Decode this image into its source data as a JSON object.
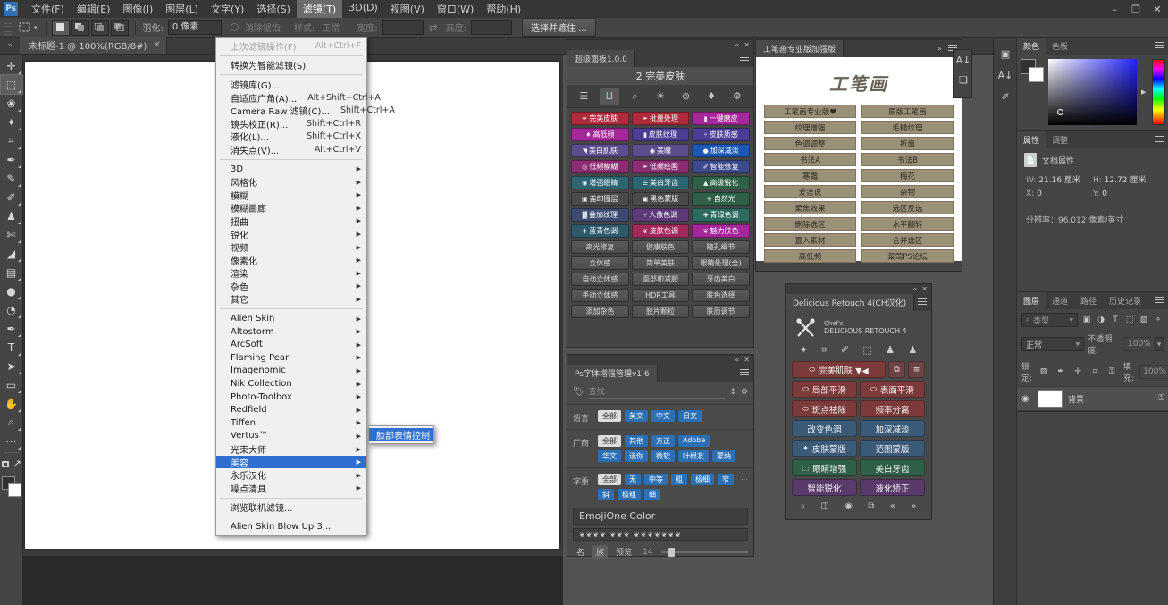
{
  "menubar": {
    "logo": "Ps",
    "items": [
      {
        "label": "文件(F)"
      },
      {
        "label": "编辑(E)"
      },
      {
        "label": "图像(I)"
      },
      {
        "label": "图层(L)"
      },
      {
        "label": "文字(Y)"
      },
      {
        "label": "选择(S)"
      },
      {
        "label": "滤镜(T)",
        "active": true
      },
      {
        "label": "3D(D)"
      },
      {
        "label": "视图(V)"
      },
      {
        "label": "窗口(W)"
      },
      {
        "label": "帮助(H)"
      }
    ],
    "window_controls": [
      "–",
      "❐",
      "✕"
    ]
  },
  "options_bar": {
    "tool_icon": "rect-marquee-icon",
    "preset_chevron": "▾",
    "mode_buttons": [
      "new-selection",
      "add-to-selection",
      "subtract-from-selection",
      "intersect-selection"
    ],
    "feather_label": "羽化:",
    "feather_value": "0 像素",
    "antialias_label": "消除锯齿",
    "style_label": "样式:",
    "style_value": "正常",
    "width_label": "宽度:",
    "width_value": "",
    "height_label": "高度:",
    "height_value": "",
    "select_and_mask": "选择并遮住 ..."
  },
  "tabbar": {
    "collapse_icon": "»",
    "document_tab": "未标题-1 @ 100%(RGB/8#)",
    "close_icon": "✕"
  },
  "toolbar": {
    "tools": [
      {
        "name": "move-tool",
        "glyph": "✛"
      },
      {
        "name": "rectangular-marquee-tool",
        "glyph": "⬚",
        "selected": true
      },
      {
        "name": "lasso-tool",
        "glyph": "❀"
      },
      {
        "name": "quick-selection-tool",
        "glyph": "✦"
      },
      {
        "name": "crop-tool",
        "glyph": "⌗"
      },
      {
        "name": "eyedropper-tool",
        "glyph": "✒"
      },
      {
        "name": "healing-brush-tool",
        "glyph": "✎"
      },
      {
        "name": "brush-tool",
        "glyph": "✐"
      },
      {
        "name": "clone-stamp-tool",
        "glyph": "♟"
      },
      {
        "name": "history-brush-tool",
        "glyph": "✄"
      },
      {
        "name": "eraser-tool",
        "glyph": "◢"
      },
      {
        "name": "gradient-tool",
        "glyph": "▤"
      },
      {
        "name": "blur-tool",
        "glyph": "●"
      },
      {
        "name": "dodge-tool",
        "glyph": "◔"
      },
      {
        "name": "pen-tool",
        "glyph": "✒"
      },
      {
        "name": "type-tool",
        "glyph": "T"
      },
      {
        "name": "path-selection-tool",
        "glyph": "➤"
      },
      {
        "name": "rectangle-tool",
        "glyph": "▭"
      },
      {
        "name": "hand-tool",
        "glyph": "✋"
      },
      {
        "name": "zoom-tool",
        "glyph": "⌕"
      },
      {
        "name": "edit-toolbar-tool",
        "glyph": "⋯"
      }
    ],
    "quickmask_icon": "quick-mask-icon",
    "screenmode_icon": "screen-mode-icon"
  },
  "superpanel": {
    "tab_title": "超级面板1.0.0",
    "section_title": "2 完美皮肤",
    "icons": [
      {
        "name": "document-icon",
        "glyph": "☰"
      },
      {
        "name": "curve-icon",
        "glyph": "⨿",
        "active": true
      },
      {
        "name": "search-icon",
        "glyph": "⌕"
      },
      {
        "name": "brightness-icon",
        "glyph": "☀"
      },
      {
        "name": "channels-icon",
        "glyph": "⊚"
      },
      {
        "name": "diamond-icon",
        "glyph": "♦"
      },
      {
        "name": "settings-icon",
        "glyph": "⚙"
      }
    ],
    "color_buttons": [
      {
        "label": "完美皮肤",
        "icon": "✒",
        "color": "#b02a3c"
      },
      {
        "label": "批量处理",
        "icon": "✒",
        "color": "#b02a3c"
      },
      {
        "label": "一键磨皮",
        "icon": "▮",
        "color": "#a5279a"
      },
      {
        "label": "高低频",
        "icon": "♦",
        "color": "#a5279a"
      },
      {
        "label": "皮肤纹理",
        "icon": "▮",
        "color": "#4b3c96"
      },
      {
        "label": "皮肤质感",
        "icon": "⑂",
        "color": "#4b3c96"
      },
      {
        "label": "美白肌肤",
        "icon": "◥",
        "color": "#5c4d8c"
      },
      {
        "label": "美瞳",
        "icon": "◉",
        "color": "#5c4d8c"
      },
      {
        "label": "加深减淡",
        "icon": "●",
        "color": "#1b58b5"
      },
      {
        "label": "低频模糊",
        "icon": "◎",
        "color": "#8c2c72"
      },
      {
        "label": "低频绘画",
        "icon": "✒",
        "color": "#8c2c72"
      },
      {
        "label": "智能修复",
        "icon": "✐",
        "color": "#3b4a8c"
      },
      {
        "label": "增强眼睛",
        "icon": "◉",
        "color": "#2d6673"
      },
      {
        "label": "美白牙齿",
        "icon": "☰",
        "color": "#2d6673"
      },
      {
        "label": "高级锐化",
        "icon": "▲",
        "color": "#2d6046"
      },
      {
        "label": "盖印图层",
        "icon": "▣",
        "color": "#4a4a4a"
      },
      {
        "label": "黑色蒙版",
        "icon": "▣",
        "color": "#4a4a4a"
      },
      {
        "label": "自然光",
        "icon": "☀",
        "color": "#2d6046"
      },
      {
        "label": "叠加纹理",
        "icon": "▓",
        "color": "#3b4a70"
      },
      {
        "label": "人像色调",
        "icon": "⑂",
        "color": "#5c3a7a"
      },
      {
        "label": "青绿色调",
        "icon": "✚",
        "color": "#2d6b5e"
      },
      {
        "label": "蓝青色调",
        "icon": "✚",
        "color": "#2d5a6b"
      },
      {
        "label": "皮肤色调",
        "icon": "❦",
        "color": "#a02a5c"
      },
      {
        "label": "魅力肤色",
        "icon": "❦",
        "color": "#a5279a"
      }
    ],
    "gray_buttons": [
      "高光修复",
      "健康肤色",
      "瞳孔细节",
      "立体感",
      "简单美肤",
      "眼睛处理(全)",
      "自动立体感",
      "面部和减肥",
      "牙齿美白",
      "手动立体感",
      "HDR工具",
      "肤色选择",
      "添加杂色",
      "胶片颗粒",
      "肤质调节"
    ]
  },
  "fontpanel": {
    "tab_title": "Ps字体增强管理v1.6",
    "tag_icon": "tag-icon",
    "search_placeholder": "查找",
    "sort_icon": "↕",
    "gear_icon": "⚙",
    "language_label": "语言",
    "language_chips": [
      {
        "label": "全部",
        "selected": true
      },
      {
        "label": "英文"
      },
      {
        "label": "中文"
      },
      {
        "label": "日文"
      }
    ],
    "vendor_label": "厂商",
    "vendor_chips": [
      {
        "label": "全部",
        "selected": true
      },
      {
        "label": "其他"
      },
      {
        "label": "方正"
      },
      {
        "label": "Adobe"
      },
      {
        "label": "华文"
      },
      {
        "label": "迷你"
      },
      {
        "label": "微软"
      },
      {
        "label": "叶根友"
      },
      {
        "label": "蒙纳"
      }
    ],
    "vendor_more": "⋯",
    "weight_label": "字重",
    "weight_chips": [
      {
        "label": "全部",
        "selected": true
      },
      {
        "label": "无"
      },
      {
        "label": "中等"
      },
      {
        "label": "粗"
      },
      {
        "label": "极细"
      },
      {
        "label": "窄"
      },
      {
        "label": "斜"
      },
      {
        "label": "极粗"
      },
      {
        "label": "细"
      }
    ],
    "weight_more": "⋯",
    "font_name": "EmojiOne Color",
    "font_sample": "❦❦❦❦ ❦❦❦ ❦❦❦❦❦❦❦",
    "footer_toggles": [
      {
        "label": "名"
      },
      {
        "label": "族",
        "selected": true
      },
      {
        "label": "预览"
      }
    ],
    "size_value": "14"
  },
  "gongbi": {
    "tab_title": "工笔画专业版加强版",
    "expand_icon": "»",
    "logo_text": "工笔画",
    "buttons": [
      "工笔画专业版♥",
      "原版工笔画",
      "纹理增强",
      "毛糙纹理",
      "色调调整",
      "折扇",
      "书法A",
      "书法B",
      "寒霜",
      "梅花",
      "爱莲说",
      "杂物",
      "柔焦效果",
      "选区反选",
      "删除选区",
      "水平翻转",
      "置入素材",
      "合并选区",
      "高低频",
      "菜莺PS论坛"
    ]
  },
  "retouch": {
    "tab_title": "Delicious Retouch 4(CH汉化)",
    "brand_small": "Chef's",
    "brand_large": "DELICIOUS RETOUCH 4",
    "logo_icon": "crossed-utensils-icon",
    "tool_icons": [
      {
        "name": "magic-wand-icon",
        "glyph": "✦"
      },
      {
        "name": "bandage-icon",
        "glyph": "⌗"
      },
      {
        "name": "brush-icon",
        "glyph": "✐"
      },
      {
        "name": "marquee-icon",
        "glyph": "⬚"
      },
      {
        "name": "stamp-icon",
        "glyph": "♟"
      },
      {
        "name": "stamp-plus-icon",
        "glyph": "♟"
      }
    ],
    "rows": [
      [
        {
          "label": "完美肌肤 ▼◀",
          "color": "#7d3a3a",
          "icon": "⬭",
          "flex": 3
        },
        {
          "square": true,
          "icon": "⧉"
        },
        {
          "square": true,
          "icon": "≡"
        }
      ],
      [
        {
          "label": "局部平滑",
          "color": "#7d3a3a",
          "icon": "⬭"
        },
        {
          "label": "表面平滑",
          "color": "#7d3a3a",
          "icon": "⬭"
        }
      ],
      [
        {
          "label": "斑点祛除",
          "color": "#7d3a3a",
          "icon": "⬭"
        },
        {
          "label": "频率分离",
          "color": "#7d3a3a"
        }
      ],
      [
        {
          "label": "改变色调",
          "color": "#3a5a78"
        },
        {
          "label": "加深减淡",
          "color": "#3a5a78"
        }
      ],
      [
        {
          "label": "皮肤蒙版",
          "color": "#3a5a78",
          "icon": "✦"
        },
        {
          "label": "范围蒙版",
          "color": "#3a5a78"
        }
      ],
      [
        {
          "label": "眼睛增强",
          "color": "#2f6047",
          "icon": "⬚"
        },
        {
          "label": "美白牙齿",
          "color": "#2f6047"
        }
      ],
      [
        {
          "label": "智能锐化",
          "color": "#5a3a6b"
        },
        {
          "label": "液化矫正",
          "color": "#5a3a6b"
        }
      ]
    ],
    "footer_icons": [
      {
        "name": "search-icon",
        "glyph": "⌕"
      },
      {
        "name": "compare-icon",
        "glyph": "◫"
      },
      {
        "name": "preview-icon",
        "glyph": "◉"
      },
      {
        "name": "copy-icon",
        "glyph": "⧉"
      },
      {
        "name": "prev-icon",
        "glyph": "«"
      },
      {
        "name": "next-icon",
        "glyph": "»"
      }
    ]
  },
  "rail": {
    "icons": [
      {
        "name": "adjustments-icon",
        "glyph": "A↓"
      },
      {
        "name": "library-icon",
        "glyph": "❑"
      }
    ]
  },
  "dock": {
    "strip_icons": [
      {
        "name": "collapse-icon",
        "glyph": "▣"
      },
      {
        "name": "actions-icon",
        "glyph": "A↓"
      },
      {
        "name": "brushes-icon",
        "glyph": "✐"
      }
    ],
    "color_panel": {
      "tabs": [
        {
          "label": "颜色",
          "active": true
        },
        {
          "label": "色板"
        }
      ],
      "foreground": "#313131",
      "background": "#ffffff",
      "field_color": "#2222ff"
    },
    "properties_panel": {
      "tabs": [
        {
          "label": "属性",
          "active": true
        },
        {
          "label": "调整"
        }
      ],
      "doc_title": "文档属性",
      "doc_icon": "document-icon",
      "w_label": "W:",
      "w_value": "21.16 厘米",
      "h_label": "H:",
      "h_value": "12.72 厘米",
      "x_label": "X:",
      "x_value": "0",
      "y_label": "Y:",
      "y_value": "0",
      "resolution": "分辨率：96.012 像素/英寸"
    },
    "layers_panel": {
      "tabs": [
        {
          "label": "图层",
          "active": true
        },
        {
          "label": "通道"
        },
        {
          "label": "路径"
        },
        {
          "label": "历史记录"
        }
      ],
      "filter_placeholder": "类型",
      "filter_icons": [
        {
          "name": "pixel-filter-icon",
          "glyph": "▣"
        },
        {
          "name": "adjustment-filter-icon",
          "glyph": "◑"
        },
        {
          "name": "type-filter-icon",
          "glyph": "T"
        },
        {
          "name": "shape-filter-icon",
          "glyph": "⬚"
        },
        {
          "name": "smart-filter-icon",
          "glyph": "▧"
        },
        {
          "name": "filter-toggle-icon",
          "glyph": "⚬"
        }
      ],
      "blend_mode": "正常",
      "opacity_label": "不透明度:",
      "opacity_value": "100%",
      "lock_label": "锁定:",
      "lock_icons": [
        {
          "name": "lock-transparency-icon",
          "glyph": "▨"
        },
        {
          "name": "lock-image-icon",
          "glyph": "✒"
        },
        {
          "name": "lock-position-icon",
          "glyph": "✛"
        },
        {
          "name": "lock-artboard-icon",
          "glyph": "⌗"
        },
        {
          "name": "lock-all-icon",
          "glyph": "⚿"
        }
      ],
      "fill_label": "填充:",
      "fill_value": "100%",
      "layer": {
        "name": "背景",
        "visible_icon": "◉",
        "lock_icon": "⚿"
      }
    }
  },
  "filter_menu": {
    "groups": [
      [
        {
          "label": "上次滤镜操作(F)",
          "shortcut": "Alt+Ctrl+F",
          "disabled": true
        }
      ],
      [
        {
          "label": "转换为智能滤镜(S)"
        }
      ],
      [
        {
          "label": "滤镜库(G)..."
        },
        {
          "label": "自适应广角(A)...",
          "shortcut": "Alt+Shift+Ctrl+A"
        },
        {
          "label": "Camera Raw 滤镜(C)...",
          "shortcut": "Shift+Ctrl+A"
        },
        {
          "label": "镜头校正(R)...",
          "shortcut": "Shift+Ctrl+R"
        },
        {
          "label": "液化(L)...",
          "shortcut": "Shift+Ctrl+X"
        },
        {
          "label": "消失点(V)...",
          "shortcut": "Alt+Ctrl+V"
        }
      ],
      [
        {
          "label": "3D",
          "submenu": true
        },
        {
          "label": "风格化",
          "submenu": true
        },
        {
          "label": "模糊",
          "submenu": true
        },
        {
          "label": "模糊画廊",
          "submenu": true
        },
        {
          "label": "扭曲",
          "submenu": true
        },
        {
          "label": "锐化",
          "submenu": true
        },
        {
          "label": "视频",
          "submenu": true
        },
        {
          "label": "像素化",
          "submenu": true
        },
        {
          "label": "渲染",
          "submenu": true
        },
        {
          "label": "杂色",
          "submenu": true
        },
        {
          "label": "其它",
          "submenu": true
        }
      ],
      [
        {
          "label": "Alien Skin",
          "submenu": true
        },
        {
          "label": "Altostorm",
          "submenu": true
        },
        {
          "label": "ArcSoft",
          "submenu": true
        },
        {
          "label": "Flaming Pear",
          "submenu": true
        },
        {
          "label": "Imagenomic",
          "submenu": true
        },
        {
          "label": "Nik Collection",
          "submenu": true
        },
        {
          "label": "Photo-Toolbox",
          "submenu": true
        },
        {
          "label": "Redfield",
          "submenu": true
        },
        {
          "label": "Tiffen",
          "submenu": true
        },
        {
          "label": "Vertus™",
          "submenu": true
        },
        {
          "label": "光束大师",
          "submenu": true
        },
        {
          "label": "美容",
          "submenu": true,
          "selected": true
        },
        {
          "label": "永乐汉化",
          "submenu": true
        },
        {
          "label": "噪点清具",
          "submenu": true
        }
      ],
      [
        {
          "label": "浏览联机滤镜..."
        }
      ],
      [
        {
          "label": "Alien Skin Blow Up 3..."
        }
      ]
    ],
    "submenu": {
      "items": [
        {
          "label": "脸部表情控制",
          "selected": true
        }
      ]
    }
  }
}
